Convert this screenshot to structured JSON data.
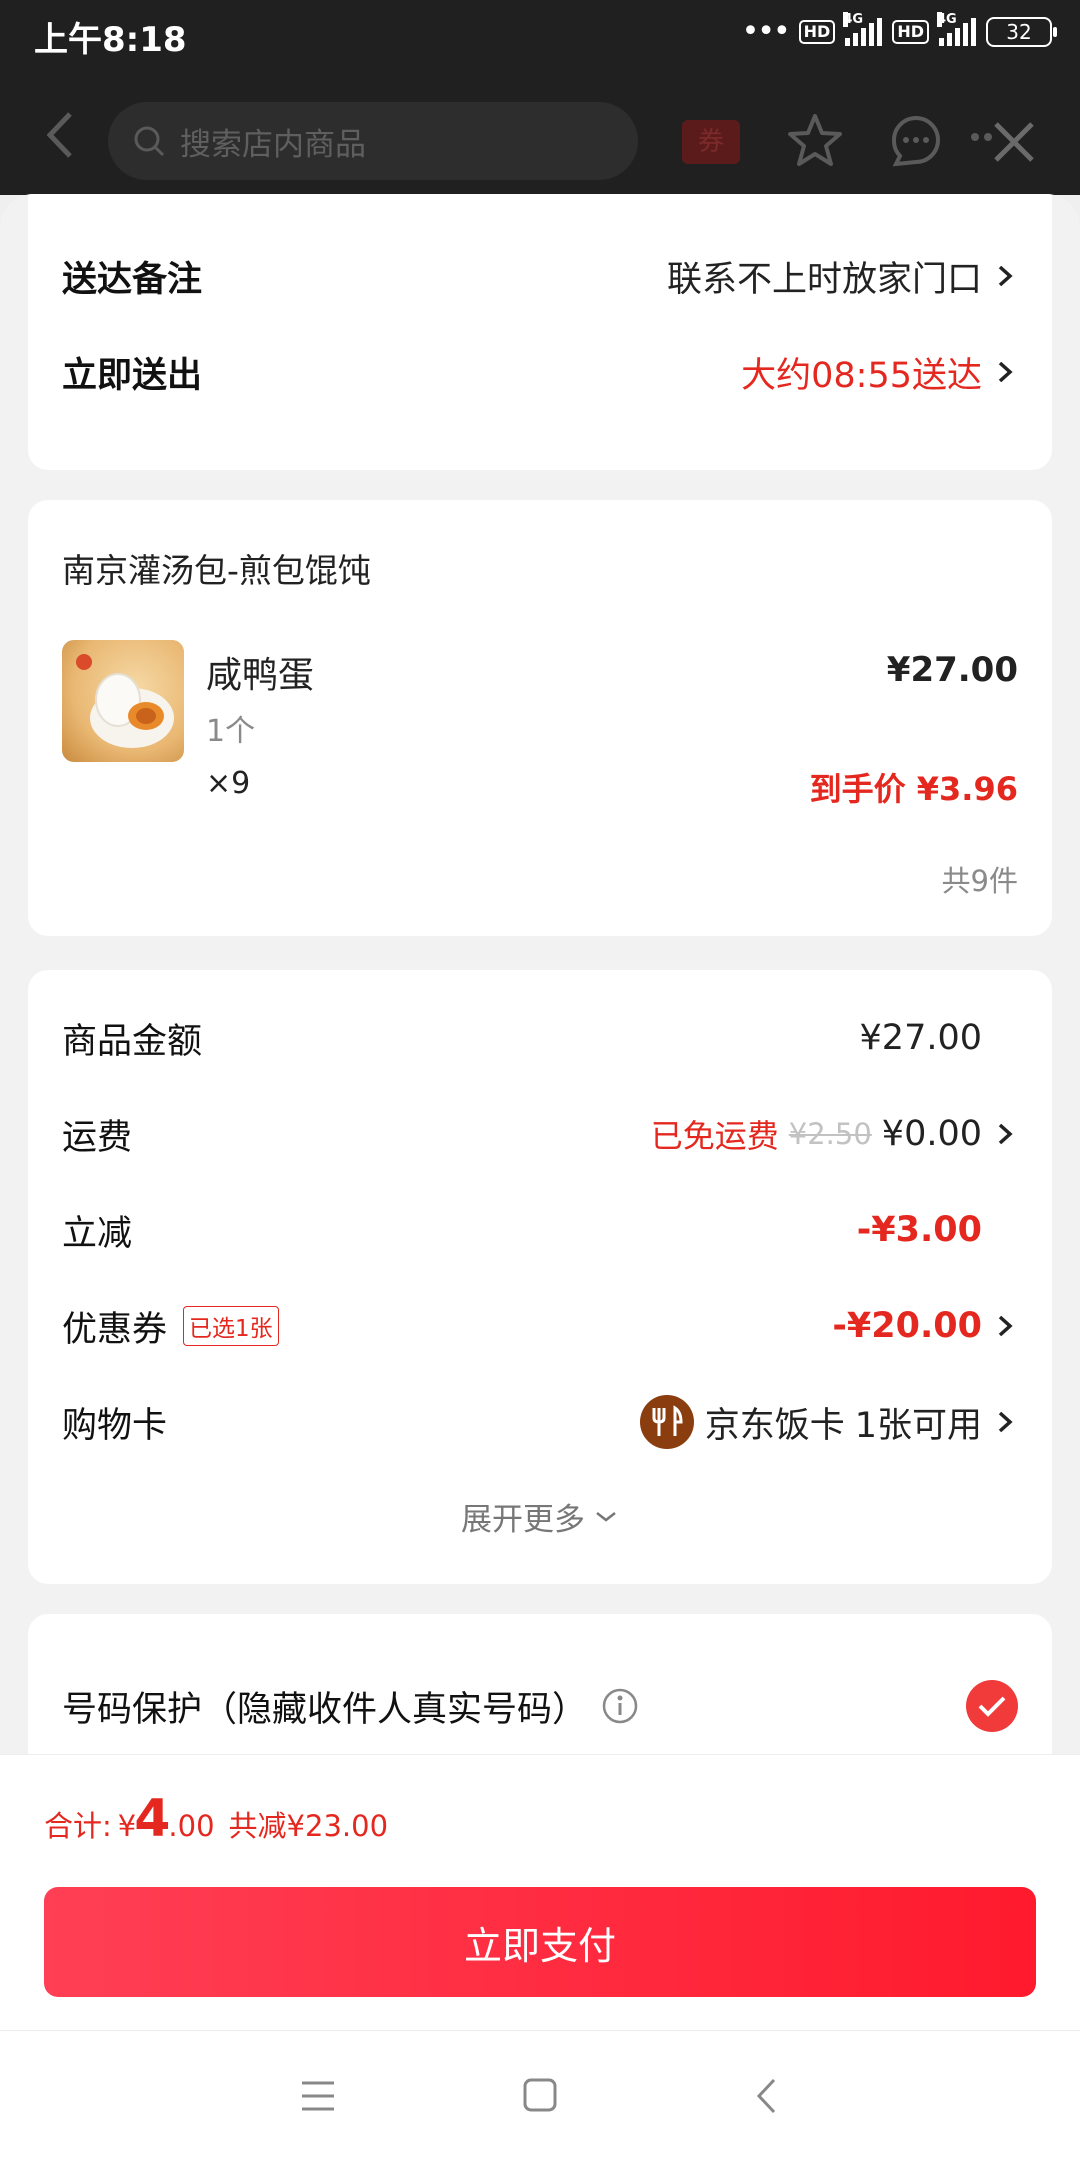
{
  "status_bar": {
    "time": "上午8:18",
    "network1": "4G",
    "network2": "4G",
    "hd": "HD",
    "battery": "32"
  },
  "header": {
    "search_placeholder": "搜索店内商品",
    "coupon_label": "券"
  },
  "delivery": {
    "note_label": "送达备注",
    "note_value": "联系不上时放家门口",
    "send_label": "立即送出",
    "send_value": "大约08:55送达"
  },
  "order": {
    "store_name": "南京灌汤包-煎包馄饨",
    "item_name": "咸鸭蛋",
    "item_spec": "1个",
    "item_qty": "×9",
    "item_price": "¥27.00",
    "final_price": "到手价 ¥3.96",
    "count": "共9件"
  },
  "summary": {
    "goods_label": "商品金额",
    "goods_value": "¥27.00",
    "shipping_label": "运费",
    "shipping_free": "已免运费",
    "shipping_original": "¥2.50",
    "shipping_value": "¥0.00",
    "discount_label": "立减",
    "discount_value": "-¥3.00",
    "coupon_label": "优惠券",
    "coupon_badge": "已选1张",
    "coupon_value": "-¥20.00",
    "card_label": "购物卡",
    "card_name": "京东饭卡",
    "card_avail": "1张可用",
    "expand": "展开更多"
  },
  "privacy": {
    "label": "号码保护（隐藏收件人真实号码）",
    "checked": true
  },
  "footer": {
    "total_prefix": "合计:",
    "currency": "¥",
    "total_int": "4",
    "total_dec": ".00",
    "saved": "共减¥23.00",
    "pay_button": "立即支付"
  },
  "colors": {
    "accent_red": "#e4281f",
    "pay_start": "#ff3f55",
    "pay_end": "#ff1a2d"
  }
}
